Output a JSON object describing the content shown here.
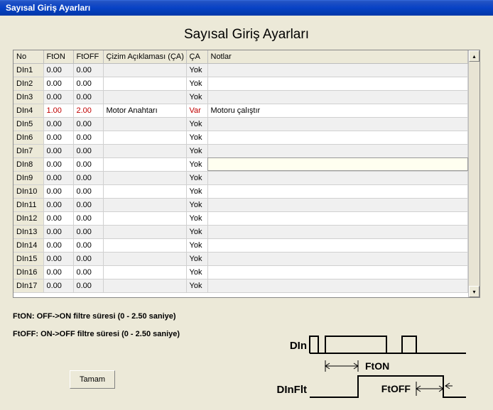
{
  "window": {
    "title": "Sayısal Giriş Ayarları"
  },
  "heading": "Sayısal Giriş Ayarları",
  "columns": {
    "no": "No",
    "fton": "FtON",
    "ftoff": "FtOFF",
    "desc": "Çizim Açıklaması (ÇA)",
    "ca": "ÇA",
    "notes": "Notlar"
  },
  "rows": [
    {
      "no": "DIn1",
      "fton": "0.00",
      "ftoff": "0.00",
      "desc": "",
      "ca": "Yok",
      "notes": ""
    },
    {
      "no": "DIn2",
      "fton": "0.00",
      "ftoff": "0.00",
      "desc": "",
      "ca": "Yok",
      "notes": ""
    },
    {
      "no": "DIn3",
      "fton": "0.00",
      "ftoff": "0.00",
      "desc": "",
      "ca": "Yok",
      "notes": ""
    },
    {
      "no": "DIn4",
      "fton": "1.00",
      "ftoff": "2.00",
      "desc": "Motor Anahtarı",
      "ca": "Var",
      "notes": "Motoru çalıştır",
      "hl": true
    },
    {
      "no": "DIn5",
      "fton": "0.00",
      "ftoff": "0.00",
      "desc": "",
      "ca": "Yok",
      "notes": ""
    },
    {
      "no": "DIn6",
      "fton": "0.00",
      "ftoff": "0.00",
      "desc": "",
      "ca": "Yok",
      "notes": ""
    },
    {
      "no": "DIn7",
      "fton": "0.00",
      "ftoff": "0.00",
      "desc": "",
      "ca": "Yok",
      "notes": ""
    },
    {
      "no": "DIn8",
      "fton": "0.00",
      "ftoff": "0.00",
      "desc": "",
      "ca": "Yok",
      "notes": "",
      "editing": true
    },
    {
      "no": "DIn9",
      "fton": "0.00",
      "ftoff": "0.00",
      "desc": "",
      "ca": "Yok",
      "notes": ""
    },
    {
      "no": "DIn10",
      "fton": "0.00",
      "ftoff": "0.00",
      "desc": "",
      "ca": "Yok",
      "notes": ""
    },
    {
      "no": "DIn11",
      "fton": "0.00",
      "ftoff": "0.00",
      "desc": "",
      "ca": "Yok",
      "notes": ""
    },
    {
      "no": "DIn12",
      "fton": "0.00",
      "ftoff": "0.00",
      "desc": "",
      "ca": "Yok",
      "notes": ""
    },
    {
      "no": "DIn13",
      "fton": "0.00",
      "ftoff": "0.00",
      "desc": "",
      "ca": "Yok",
      "notes": ""
    },
    {
      "no": "DIn14",
      "fton": "0.00",
      "ftoff": "0.00",
      "desc": "",
      "ca": "Yok",
      "notes": ""
    },
    {
      "no": "DIn15",
      "fton": "0.00",
      "ftoff": "0.00",
      "desc": "",
      "ca": "Yok",
      "notes": ""
    },
    {
      "no": "DIn16",
      "fton": "0.00",
      "ftoff": "0.00",
      "desc": "",
      "ca": "Yok",
      "notes": ""
    },
    {
      "no": "DIn17",
      "fton": "0.00",
      "ftoff": "0.00",
      "desc": "",
      "ca": "Yok",
      "notes": ""
    }
  ],
  "legend": {
    "fton": "FtON: OFF->ON filtre süresi (0 - 2.50 saniye)",
    "ftoff": "FtOFF: ON->OFF filtre süresi (0 - 2.50 saniye)"
  },
  "diagram": {
    "din": "DIn",
    "dinflt": "DInFlt",
    "fton": "FtON",
    "ftoff": "FtOFF"
  },
  "buttons": {
    "ok": "Tamam"
  }
}
